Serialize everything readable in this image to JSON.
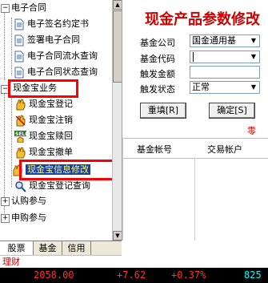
{
  "tree": {
    "contract_group": "电子合同",
    "contract_items": [
      "电子签名约定书",
      "签署电子合同",
      "电子合同流水查询",
      "电子合同状态查询"
    ],
    "cash_group": "现金宝业务",
    "cash_items": [
      "现金宝登记",
      "现金宝注销",
      "现金宝赎回",
      "现金宝撤单",
      "现金宝信息修改",
      "现金宝登记查询"
    ],
    "sub_group": "认购参与",
    "apply_group": "申购参与"
  },
  "tabs": [
    "股票",
    "基金",
    "信用"
  ],
  "licai_label": "理财",
  "form": {
    "title": "现金产品参数修改",
    "labels": {
      "fund_company": "基金公司",
      "fund_code": "基金代码",
      "trigger_amount": "触发金额",
      "trigger_status": "触发状态"
    },
    "values": {
      "fund_company": "国金通用基",
      "fund_code": "",
      "trigger_amount": "",
      "trigger_status": "正常"
    },
    "reset_button": "重填[R]",
    "confirm_button": "确定[S]",
    "zero_label": "零"
  },
  "table": {
    "headers": [
      "基金帐号",
      "交易帐户"
    ]
  },
  "status_bar": {
    "index": "2058.00",
    "change": "+7.62",
    "percent": "+0.37%",
    "volume": "825"
  },
  "colors": {
    "title_red": "#cc0000",
    "highlight_box": "#ff0000",
    "selected_bg": "#1a3f9c",
    "status_red": "#ff3030",
    "status_cyan": "#00ffff"
  },
  "icons": {
    "doc": "document-icon",
    "hand": "hand-icon",
    "sell": "sell-icon",
    "search": "magnifier-icon"
  }
}
